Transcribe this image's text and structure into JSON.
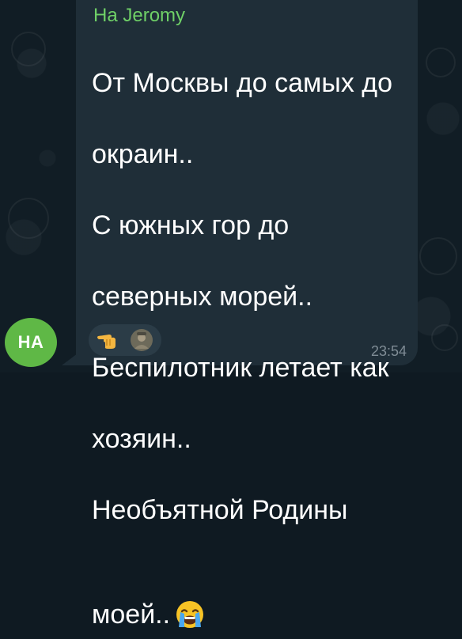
{
  "message": {
    "sender": "На Jeromy",
    "lines": [
      "От Москвы до самых до",
      "окраин..",
      "С южных гор до",
      "северных морей..",
      "Беспилотник летает как",
      "хозяин..",
      "Необъятной Родины",
      "моей.."
    ],
    "inline_emoji": "loudly-crying-face-icon",
    "time": "23:54"
  },
  "avatar": {
    "initials": "НА",
    "color": "#5fb846"
  },
  "reactions": [
    {
      "icon": "pointing-hand-icon"
    },
    {
      "icon": "user-avatar-icon"
    }
  ],
  "colors": {
    "bubble": "#1f2e38",
    "sender": "#6fd067",
    "background": "#111d25"
  }
}
